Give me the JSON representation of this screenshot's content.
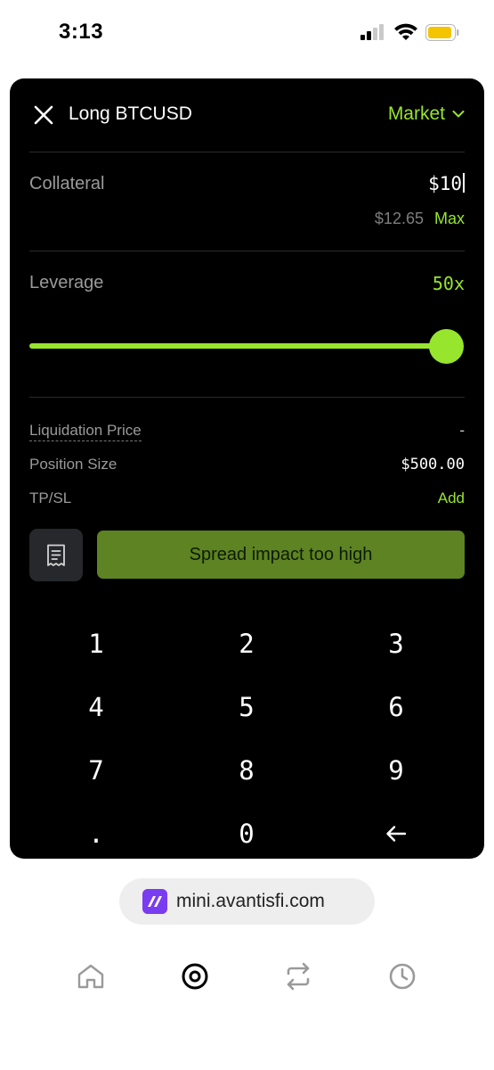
{
  "status_bar": {
    "time": "3:13"
  },
  "header": {
    "title": "Long BTCUSD",
    "order_type": "Market"
  },
  "collateral": {
    "label": "Collateral",
    "value": "$10",
    "balance": "$12.65",
    "max_label": "Max"
  },
  "leverage": {
    "label": "Leverage",
    "value": "50x",
    "slider_fraction": 1.0
  },
  "info": {
    "liquidation_label": "Liquidation Price",
    "liquidation_value": "-",
    "position_size_label": "Position Size",
    "position_size_value": "$500.00",
    "tpsl_label": "TP/SL",
    "tpsl_action": "Add"
  },
  "actions": {
    "submit_label": "Spread impact too high"
  },
  "keypad": {
    "keys": [
      "1",
      "2",
      "3",
      "4",
      "5",
      "6",
      "7",
      "8",
      "9",
      ".",
      "0"
    ]
  },
  "browser": {
    "url": "mini.avantisfi.com"
  },
  "colors": {
    "accent": "#97e52d",
    "submit_bg": "#5d8322",
    "card_bg": "#000000"
  },
  "icons": {
    "close": "close-icon",
    "chevron": "chevron-down-icon",
    "receipt": "receipt-icon",
    "backspace": "backspace-arrow-icon",
    "nav": [
      "home-icon",
      "compass-icon",
      "swap-icon",
      "history-icon"
    ]
  }
}
